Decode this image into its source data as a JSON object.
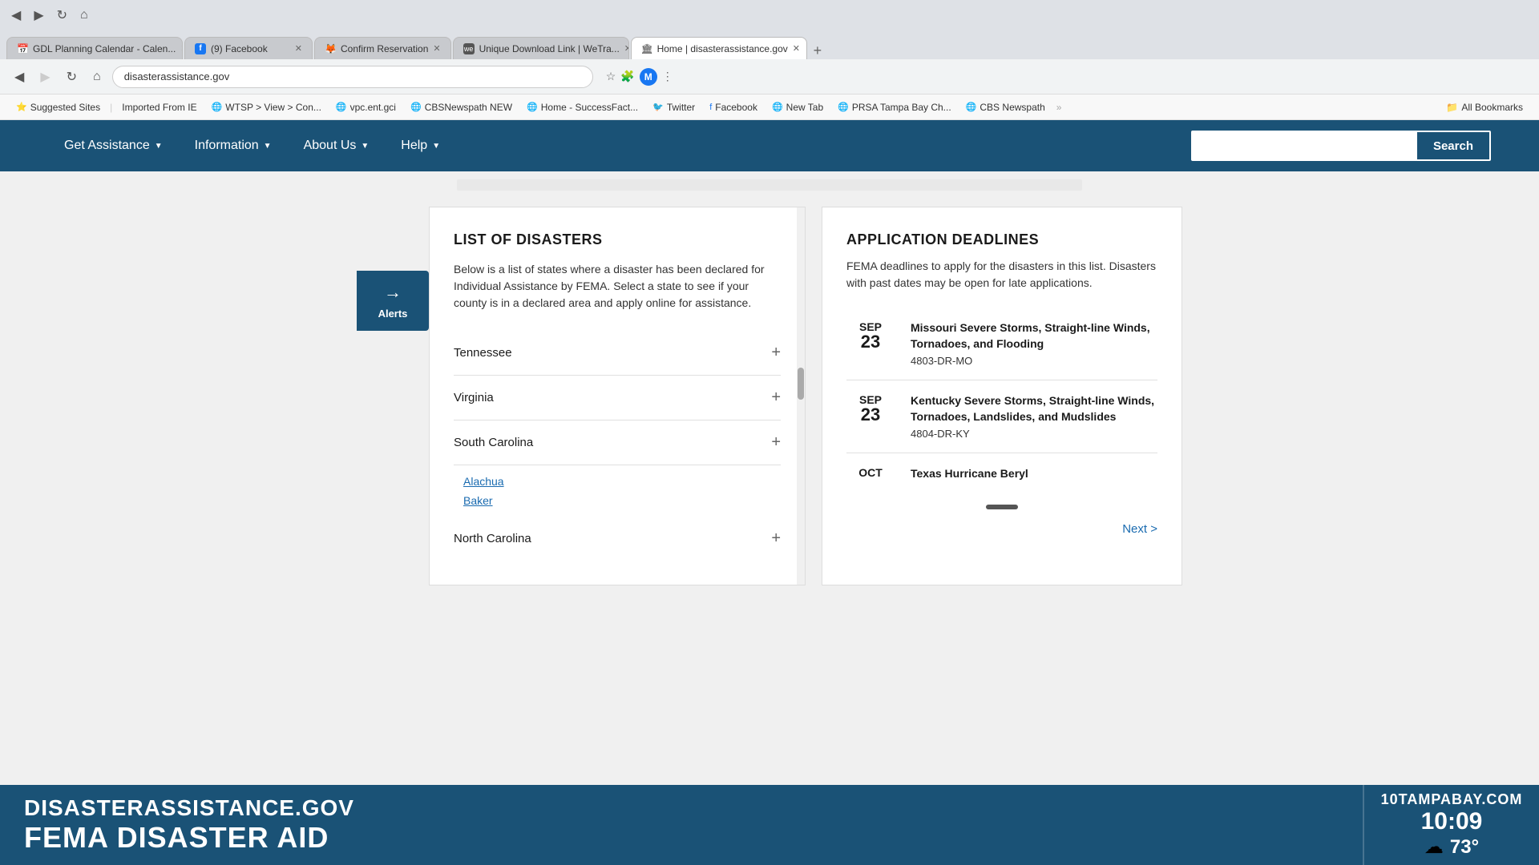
{
  "browser": {
    "tabs": [
      {
        "label": "GDL Planning Calendar - Calen...",
        "favicon": "📅",
        "active": false
      },
      {
        "label": "(9) Facebook",
        "favicon": "f",
        "active": false,
        "favicon_bg": "#1877f2",
        "favicon_color": "#fff"
      },
      {
        "label": "Confirm Reservation",
        "favicon": "🦊",
        "active": false
      },
      {
        "label": "Unique Download Link | WeTra...",
        "favicon": "we",
        "active": false
      },
      {
        "label": "Home | disasterassistance.gov",
        "favicon": "🏛",
        "active": true
      }
    ],
    "url": "disasterassistance.gov"
  },
  "bookmarks": [
    {
      "label": "Suggested Sites"
    },
    {
      "label": "Imported From IE"
    },
    {
      "label": "WTSP > View > Con..."
    },
    {
      "label": "vpc.ent.gci"
    },
    {
      "label": "CBSNewspath NEW"
    },
    {
      "label": "Home - SuccessFact..."
    },
    {
      "label": "Twitter"
    },
    {
      "label": "Facebook"
    },
    {
      "label": "New Tab"
    },
    {
      "label": "PRSA Tampa Bay Ch..."
    },
    {
      "label": "CBS Newspath"
    }
  ],
  "nav": {
    "items": [
      {
        "label": "Get Assistance",
        "has_dropdown": true
      },
      {
        "label": "Information",
        "has_dropdown": true
      },
      {
        "label": "About Us",
        "has_dropdown": true
      },
      {
        "label": "Help",
        "has_dropdown": true
      }
    ],
    "search_placeholder": "",
    "search_btn": "Search"
  },
  "disasters": {
    "title": "LIST OF DISASTERS",
    "description": "Below is a list of states where a disaster has been declared for Individual Assistance by FEMA. Select a state to see if your county is in a declared area and apply online for assistance.",
    "items": [
      {
        "name": "Tennessee",
        "expanded": false
      },
      {
        "name": "Virginia",
        "expanded": false
      },
      {
        "name": "South Carolina",
        "expanded": true
      },
      {
        "name": "North Carolina",
        "expanded": false
      }
    ],
    "sub_items": [
      {
        "name": "Alachua"
      },
      {
        "name": "Baker"
      }
    ]
  },
  "deadlines": {
    "title": "APPLICATION DEADLINES",
    "description": "FEMA deadlines to apply for the disasters in this list. Disasters with past dates may be open for late applications.",
    "entries": [
      {
        "month": "SEP",
        "day": "23",
        "event": "Missouri Severe Storms, Straight-line Winds, Tornadoes, and Flooding",
        "code": "4803-DR-MO"
      },
      {
        "month": "SEP",
        "day": "23",
        "event": "Kentucky Severe Storms, Straight-line Winds, Tornadoes, Landslides, and Mudslides",
        "code": "4804-DR-KY"
      },
      {
        "month": "OCT",
        "day": "",
        "event": "Texas Hurricane Beryl",
        "code": ""
      }
    ],
    "next_label": "Next >"
  },
  "alerts": {
    "icon": "→",
    "label": "Alerts"
  },
  "tv_overlay": {
    "site": "DISASTERASSISTANCE.GOV",
    "title": "FEMA DISASTER AID",
    "station": "10TAMPABAY.COM",
    "time": "10:09",
    "weather_icon": "☁",
    "temp": "73°"
  }
}
